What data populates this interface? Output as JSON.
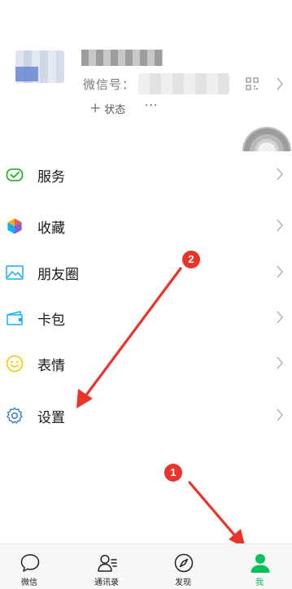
{
  "profile": {
    "wechat_id_label": "微信号：",
    "status_label": "状态",
    "more_label": "···"
  },
  "menu": {
    "items": [
      {
        "label": "服务",
        "icon": "service-icon"
      },
      {
        "label": "收藏",
        "icon": "favorites-icon"
      },
      {
        "label": "朋友圈",
        "icon": "moments-icon"
      },
      {
        "label": "卡包",
        "icon": "card-wallet-icon"
      },
      {
        "label": "表情",
        "icon": "sticker-icon"
      },
      {
        "label": "设置",
        "icon": "settings-icon"
      }
    ]
  },
  "annotations": {
    "badge_1": "1",
    "badge_2": "2"
  },
  "tabbar": {
    "tabs": [
      {
        "label": "微信",
        "icon": "chat-icon"
      },
      {
        "label": "通讯录",
        "icon": "contacts-icon"
      },
      {
        "label": "发现",
        "icon": "discover-icon"
      },
      {
        "label": "我",
        "icon": "me-icon",
        "active": true
      }
    ]
  },
  "colors": {
    "accent": "#07c160",
    "annotation": "#e8342b",
    "chevron": "#b2b2b2"
  }
}
